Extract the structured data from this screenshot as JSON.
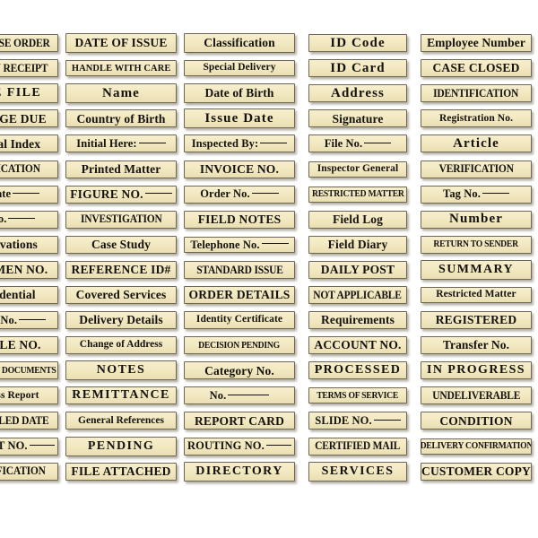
{
  "sheet": {
    "title": "Vintage Ephemera Label Sticker Sheet",
    "background_color": "#ffffff",
    "label_fill_color": "#f3e9c2",
    "label_border_color": "#6e6654",
    "label_text_color": "#14120d",
    "columns": 5,
    "rows": 18
  },
  "columns": [
    {
      "name": "column-1",
      "clipped": "left",
      "labels": [
        {
          "text": "PURCHASE ORDER",
          "style": "t-caps-narrow",
          "w": "w-full",
          "h": "h-std"
        },
        {
          "text": "RETURN RECEIPT",
          "style": "t-caps-narrow",
          "w": "w-full",
          "h": "h-std"
        },
        {
          "text": "CASE FILE",
          "style": "t-caps-space",
          "w": "w-full",
          "h": "h-tall"
        },
        {
          "text": "POSTAGE DUE",
          "style": "t-caps-bold",
          "w": "w-full",
          "h": "h-std"
        },
        {
          "text": "General Index",
          "style": "t-title",
          "w": "w-full",
          "h": "h-std"
        },
        {
          "text": "VERIFICATION",
          "style": "t-caps-narrow",
          "w": "w-full",
          "h": "h-std"
        },
        {
          "text": "Due Date",
          "style": "t-blank",
          "w": "w-full",
          "h": "h-std",
          "rule": "r-md"
        },
        {
          "text": "Ref No.",
          "style": "t-blank",
          "w": "w-full",
          "h": "h-std",
          "rule": "r-md"
        },
        {
          "text": "Observations",
          "style": "t-title",
          "w": "w-full",
          "h": "h-std"
        },
        {
          "text": "SPECIMEN NO.",
          "style": "t-caps-bold",
          "w": "w-full",
          "h": "h-std"
        },
        {
          "text": "Confidential",
          "style": "t-title",
          "w": "w-full",
          "h": "h-std"
        },
        {
          "text": "Catalog No.",
          "style": "t-blank",
          "w": "w-full",
          "h": "h-std",
          "rule": "r-md"
        },
        {
          "text": "SAMPLE NO.",
          "style": "t-caps-bold",
          "w": "w-full",
          "h": "h-std"
        },
        {
          "text": "IMPORTANT DOCUMENTS",
          "style": "t-caps-tight",
          "w": "w-full",
          "h": "h-std"
        },
        {
          "text": "Progress Report",
          "style": "t-title-sm",
          "w": "w-full",
          "h": "h-std"
        },
        {
          "text": "SCHEDULED DATE",
          "style": "t-caps-narrow",
          "w": "w-full",
          "h": "h-std"
        },
        {
          "text": "REQUEST NO.",
          "style": "t-blank",
          "w": "w-full",
          "h": "h-std",
          "rule": "r-md"
        },
        {
          "text": "CLASSIFICATION",
          "style": "t-caps-narrow",
          "w": "w-full",
          "h": "h-std"
        }
      ]
    },
    {
      "name": "column-2",
      "clipped": "none",
      "labels": [
        {
          "text": "DATE OF ISSUE",
          "style": "t-caps-bold",
          "w": "w-full",
          "h": "h-tall"
        },
        {
          "text": "HANDLE WITH CARE",
          "style": "t-caps-cond",
          "w": "w-full",
          "h": "h-short"
        },
        {
          "text": "Name",
          "style": "t-title-lg",
          "w": "w-full",
          "h": "h-tall"
        },
        {
          "text": "Country of Birth",
          "style": "t-title",
          "w": "w-full",
          "h": "h-std"
        },
        {
          "text": "Initial Here:",
          "style": "t-blank",
          "w": "w-full",
          "h": "h-std",
          "rule": "r-md"
        },
        {
          "text": "Printed Matter",
          "style": "t-title",
          "w": "w-full",
          "h": "h-std"
        },
        {
          "text": "FIGURE NO.",
          "style": "t-caps-bold",
          "w": "w-full",
          "h": "h-std",
          "rule": "r-md"
        },
        {
          "text": "INVESTIGATION",
          "style": "t-caps-narrow",
          "w": "w-full",
          "h": "h-std"
        },
        {
          "text": "Case Study",
          "style": "t-title",
          "w": "w-full",
          "h": "h-std"
        },
        {
          "text": "REFERENCE ID#",
          "style": "t-caps-bold",
          "w": "w-full",
          "h": "h-std"
        },
        {
          "text": "Covered Services",
          "style": "t-title",
          "w": "w-full",
          "h": "h-std"
        },
        {
          "text": "Delivery Details",
          "style": "t-title",
          "w": "w-full",
          "h": "h-std"
        },
        {
          "text": "Change of Address",
          "style": "t-script-sm",
          "w": "w-full",
          "h": "h-std"
        },
        {
          "text": "NOTES",
          "style": "t-caps-space",
          "w": "w-full",
          "h": "h-tall"
        },
        {
          "text": "REMITTANCE",
          "style": "t-caps-space",
          "w": "w-full",
          "h": "h-std"
        },
        {
          "text": "General References",
          "style": "t-script-sm",
          "w": "w-full",
          "h": "h-std"
        },
        {
          "text": "PENDING",
          "style": "t-caps-space",
          "w": "w-full",
          "h": "h-tall"
        },
        {
          "text": "FILE ATTACHED",
          "style": "t-caps-bold",
          "w": "w-full",
          "h": "h-std"
        }
      ]
    },
    {
      "name": "column-3",
      "clipped": "none",
      "labels": [
        {
          "text": "Classification",
          "style": "t-title",
          "w": "w-full",
          "h": "h-tall"
        },
        {
          "text": "Special Delivery",
          "style": "t-title-sm",
          "w": "w-full",
          "h": "h-short"
        },
        {
          "text": "Date of Birth",
          "style": "t-title",
          "w": "w-full",
          "h": "h-tall"
        },
        {
          "text": "Issue Date",
          "style": "t-title-lg",
          "w": "w-full",
          "h": "h-tall"
        },
        {
          "text": "Inspected By:",
          "style": "t-blank",
          "w": "w-full",
          "h": "h-std",
          "rule": "r-md"
        },
        {
          "text": "INVOICE NO.",
          "style": "t-caps-bold",
          "w": "w-full",
          "h": "h-std"
        },
        {
          "text": "Order No.",
          "style": "t-blank",
          "w": "w-full",
          "h": "h-std",
          "rule": "r-md"
        },
        {
          "text": "FIELD NOTES",
          "style": "t-caps-bold",
          "w": "w-full",
          "h": "h-std"
        },
        {
          "text": "Telephone No.",
          "style": "t-blank",
          "w": "w-full",
          "h": "h-short",
          "rule": "r-md"
        },
        {
          "text": "STANDARD ISSUE",
          "style": "t-caps-narrow",
          "w": "w-full",
          "h": "h-std"
        },
        {
          "text": "ORDER DETAILS",
          "style": "t-caps-bold",
          "w": "w-full",
          "h": "h-std"
        },
        {
          "text": "Identity Certificate",
          "style": "t-title-sm",
          "w": "w-full",
          "h": "h-std"
        },
        {
          "text": "DECISION PENDING",
          "style": "t-caps-tight",
          "w": "w-full",
          "h": "h-std"
        },
        {
          "text": "Category No.",
          "style": "t-title",
          "w": "w-full",
          "h": "h-std"
        },
        {
          "text": "No.",
          "style": "t-blank",
          "w": "w-full",
          "h": "h-std",
          "rule": "r-lg"
        },
        {
          "text": "REPORT CARD",
          "style": "t-caps-bold",
          "w": "w-full",
          "h": "h-std"
        },
        {
          "text": "ROUTING NO.",
          "style": "t-blank",
          "w": "w-full",
          "h": "h-std",
          "rule": "r-md"
        },
        {
          "text": "DIRECTORY",
          "style": "t-caps-space",
          "w": "w-full",
          "h": "h-tall"
        }
      ]
    },
    {
      "name": "column-4",
      "clipped": "none",
      "labels": [
        {
          "text": "ID Code",
          "style": "t-title-lg",
          "w": "w-med",
          "h": "h-std"
        },
        {
          "text": "ID Card",
          "style": "t-title-lg",
          "w": "w-med",
          "h": "h-std"
        },
        {
          "text": "Address",
          "style": "t-title-lg",
          "w": "w-med",
          "h": "h-std"
        },
        {
          "text": "Signature",
          "style": "t-title",
          "w": "w-med",
          "h": "h-std"
        },
        {
          "text": "File No.",
          "style": "t-blank",
          "w": "w-med",
          "h": "h-std",
          "rule": "r-md"
        },
        {
          "text": "Inspector General",
          "style": "t-title-sm",
          "w": "w-med",
          "h": "h-short"
        },
        {
          "text": "RESTRICTED MATTER",
          "style": "t-caps-tight",
          "w": "w-med",
          "h": "h-short"
        },
        {
          "text": "Field Log",
          "style": "t-title",
          "w": "w-med",
          "h": "h-std"
        },
        {
          "text": "Field Diary",
          "style": "t-title",
          "w": "w-med",
          "h": "h-std"
        },
        {
          "text": "DAILY POST",
          "style": "t-caps-bold",
          "w": "w-med",
          "h": "h-std"
        },
        {
          "text": "NOT APPLICABLE",
          "style": "t-caps-narrow",
          "w": "w-med",
          "h": "h-std"
        },
        {
          "text": "Requirements",
          "style": "t-title",
          "w": "w-med",
          "h": "h-std"
        },
        {
          "text": "ACCOUNT NO.",
          "style": "t-caps-bold",
          "w": "w-med",
          "h": "h-std"
        },
        {
          "text": "PROCESSED",
          "style": "t-caps-space",
          "w": "w-med",
          "h": "h-std"
        },
        {
          "text": "TERMS OF SERVICE",
          "style": "t-caps-tight",
          "w": "w-med",
          "h": "h-short"
        },
        {
          "text": "SLIDE NO.",
          "style": "t-blank",
          "w": "w-med",
          "h": "h-std",
          "rule": "r-md"
        },
        {
          "text": "CERTIFIED MAIL",
          "style": "t-caps-narrow",
          "w": "w-med",
          "h": "h-std"
        },
        {
          "text": "SERVICES",
          "style": "t-caps-space",
          "w": "w-med",
          "h": "h-tall"
        }
      ]
    },
    {
      "name": "column-5",
      "clipped": "right",
      "labels": [
        {
          "text": "Employee Number",
          "style": "t-title",
          "w": "w-full",
          "h": "h-std"
        },
        {
          "text": "CASE CLOSED",
          "style": "t-caps-bold",
          "w": "w-full",
          "h": "h-std"
        },
        {
          "text": "IDENTIFICATION",
          "style": "t-caps-narrow",
          "w": "w-full",
          "h": "h-std"
        },
        {
          "text": "Registration No.",
          "style": "t-title-sm",
          "w": "w-full",
          "h": "h-std"
        },
        {
          "text": "Article",
          "style": "t-title-lg",
          "w": "w-full",
          "h": "h-std"
        },
        {
          "text": "VERIFICATION",
          "style": "t-caps-narrow",
          "w": "w-full",
          "h": "h-std"
        },
        {
          "text": "Tag No.",
          "style": "t-blank",
          "w": "w-full",
          "h": "h-std",
          "rule": "r-md"
        },
        {
          "text": "Number",
          "style": "t-title-lg",
          "w": "w-full",
          "h": "h-std"
        },
        {
          "text": "RETURN TO SENDER",
          "style": "t-caps-tight",
          "w": "w-full",
          "h": "h-std"
        },
        {
          "text": "SUMMARY",
          "style": "t-caps-space",
          "w": "w-full",
          "h": "h-tall"
        },
        {
          "text": "Restricted Matter",
          "style": "t-title-sm",
          "w": "w-full",
          "h": "h-short"
        },
        {
          "text": "REGISTERED",
          "style": "t-caps-bold",
          "w": "w-full",
          "h": "h-std"
        },
        {
          "text": "Transfer No.",
          "style": "t-title",
          "w": "w-full",
          "h": "h-std"
        },
        {
          "text": "IN PROGRESS",
          "style": "t-caps-space",
          "w": "w-full",
          "h": "h-std"
        },
        {
          "text": "UNDELIVERABLE",
          "style": "t-caps-narrow",
          "w": "w-full",
          "h": "h-std"
        },
        {
          "text": "CONDITION",
          "style": "t-caps-bold",
          "w": "w-full",
          "h": "h-std"
        },
        {
          "text": "DELIVERY CONFIRMATION",
          "style": "t-caps-tight",
          "w": "w-full",
          "h": "h-short"
        },
        {
          "text": "CUSTOMER COPY",
          "style": "t-caps-bold",
          "w": "w-full",
          "h": "h-std"
        }
      ]
    }
  ]
}
